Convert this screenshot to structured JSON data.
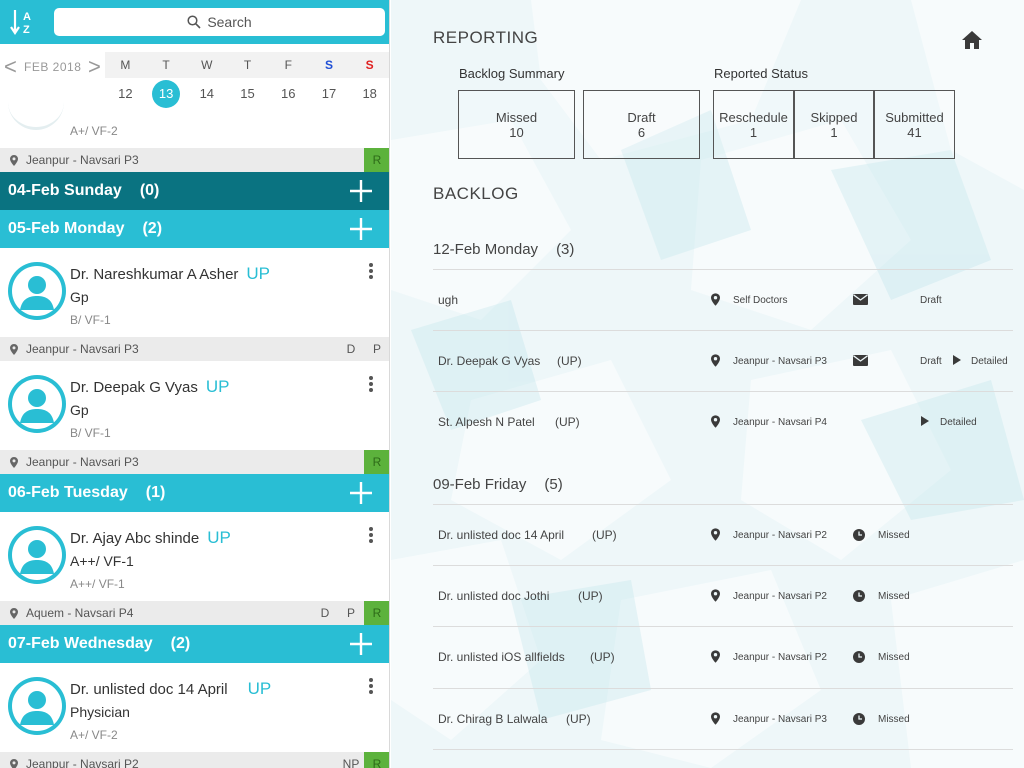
{
  "left": {
    "search_placeholder": "Search",
    "calendar": {
      "month": "FEB 2018",
      "weekdays": [
        "M",
        "T",
        "W",
        "T",
        "F",
        "S",
        "S"
      ],
      "dates": [
        "12",
        "13",
        "14",
        "15",
        "16",
        "17",
        "18"
      ],
      "selected_date": "13",
      "colors": {
        "saturday": "#1f4fd6",
        "sunday": "#e02020",
        "accent": "#29bed4"
      }
    },
    "partial_entry": {
      "class_text": "A+/ VF-2"
    },
    "first_location": {
      "text": "Jeanpur - Navsari P3",
      "tags": [
        "R"
      ]
    },
    "days": [
      {
        "label": "04-Feb Sunday",
        "count": "(0)",
        "style": "dark"
      },
      {
        "label": "05-Feb Monday",
        "count": "(2)",
        "style": "light"
      },
      {
        "label": "06-Feb Tuesday",
        "count": "(1)",
        "style": "light"
      },
      {
        "label": "07-Feb Wednesday",
        "count": "(2)",
        "style": "light"
      }
    ],
    "doctors": [
      {
        "name": "Dr. Nareshkumar A Asher",
        "badge": "UP",
        "spec": "Gp",
        "cls": "B/ VF-1",
        "location": "Jeanpur - Navsari P3",
        "tags": [
          "D",
          "P"
        ]
      },
      {
        "name": "Dr. Deepak G Vyas",
        "badge": "UP",
        "spec": "Gp",
        "cls": "B/ VF-1",
        "location": "Jeanpur - Navsari P3",
        "tags": [
          "R"
        ]
      },
      {
        "name": "Dr. Ajay Abc shinde",
        "badge": "UP",
        "spec": "A++/ VF-1",
        "cls": "A++/ VF-1",
        "location": "Aquem - Navsari P4",
        "tags": [
          "D",
          "P",
          "R"
        ]
      },
      {
        "name": "Dr. unlisted doc 14 April",
        "badge": "UP",
        "spec": "Physician",
        "cls": "A+/ VF-2",
        "location": "Jeanpur - Navsari P2",
        "tags": [
          "NP",
          "R"
        ]
      }
    ]
  },
  "right": {
    "title": "REPORTING",
    "backlog_summary_label": "Backlog Summary",
    "reported_status_label": "Reported Status",
    "summary": [
      {
        "label": "Missed",
        "value": "10"
      },
      {
        "label": "Draft",
        "value": "6"
      }
    ],
    "status": [
      {
        "label": "Reschedule",
        "value": "1"
      },
      {
        "label": "Skipped",
        "value": "1"
      },
      {
        "label": "Submitted",
        "value": "41"
      }
    ],
    "backlog_title": "BACKLOG",
    "groups": [
      {
        "label": "12-Feb Monday",
        "count": "(3)",
        "rows": [
          {
            "name": "ugh",
            "up": "",
            "location": "Self Doctors",
            "status1_icon": "mail-icon",
            "status1": "Draft",
            "status2": ""
          },
          {
            "name": "Dr. Deepak G Vyas",
            "up": "(UP)",
            "location": "Jeanpur - Navsari P3",
            "status1_icon": "mail-icon",
            "status1": "Draft",
            "status2": "Detailed"
          },
          {
            "name": "St. Alpesh N Patel",
            "up": "(UP)",
            "location": "Jeanpur - Navsari P4",
            "status1_icon": "",
            "status1": "",
            "status2": "Detailed"
          }
        ]
      },
      {
        "label": "09-Feb Friday",
        "count": "(5)",
        "rows": [
          {
            "name": "Dr. unlisted doc 14 April",
            "up": "(UP)",
            "location": "Jeanpur - Navsari P2",
            "status1_icon": "clock-icon",
            "status1": "Missed",
            "status2": ""
          },
          {
            "name": "Dr. unlisted doc Jothi",
            "up": "(UP)",
            "location": "Jeanpur - Navsari P2",
            "status1_icon": "clock-icon",
            "status1": "Missed",
            "status2": ""
          },
          {
            "name": "Dr. unlisted iOS allfields",
            "up": "(UP)",
            "location": "Jeanpur - Navsari P2",
            "status1_icon": "clock-icon",
            "status1": "Missed",
            "status2": ""
          },
          {
            "name": "Dr. Chirag B Lalwala",
            "up": "(UP)",
            "location": "Jeanpur - Navsari P3",
            "status1_icon": "clock-icon",
            "status1": "Missed",
            "status2": ""
          }
        ]
      }
    ]
  }
}
